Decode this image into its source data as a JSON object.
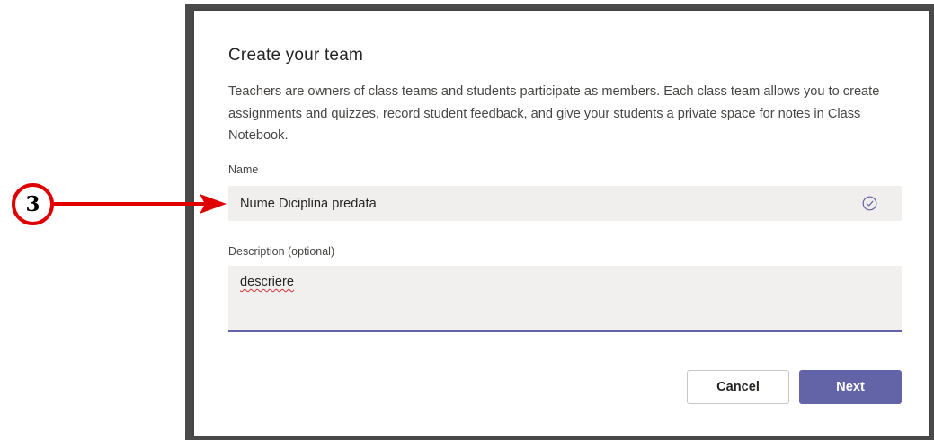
{
  "dialog": {
    "title": "Create your team",
    "description": "Teachers are owners of class teams and students participate as members. Each class team allows you to create assignments and quizzes, record student feedback, and give your students a private space for notes in Class Notebook.",
    "name_label": "Name",
    "name_value": "Nume Diciplina predata",
    "name_status_icon": "check-circle-icon",
    "description_label": "Description (optional)",
    "description_value": "descriere",
    "cancel_label": "Cancel",
    "next_label": "Next"
  },
  "annotation": {
    "step_number": "3"
  },
  "colors": {
    "accent": "#6264a7",
    "callout_red": "#e00000",
    "input_bg": "#f0efee"
  }
}
